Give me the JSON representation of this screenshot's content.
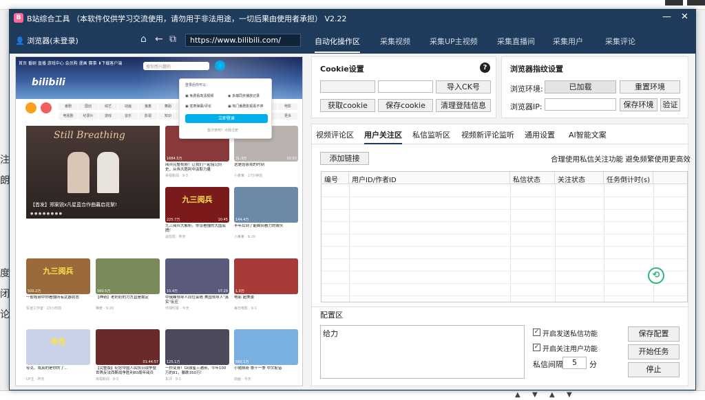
{
  "window": {
    "title": "B站综合工具 （本软件仅供学习交流使用，请勿用于非法用途，一切后果由使用者承担） V2.22",
    "logo": "B"
  },
  "background": {
    "left_fragments": [
      "注",
      "朗",
      "度:",
      "闭",
      "论"
    ]
  },
  "nav": {
    "user_label": "浏览器(未登录)",
    "url": "https://www.bilibili.com/",
    "tabs": [
      "自动化操作区",
      "采集视频",
      "采集UP主视频",
      "采集直播间",
      "采集用户",
      "采集评论"
    ],
    "active_tab": "自动化操作区"
  },
  "bili": {
    "nav_text": "首页 番剧 直播 游戏中心 会员购 漫画 赛事 ⬇下载客户端",
    "search_placeholder": "搜你感兴趣的",
    "logo": "bilibili",
    "cats": [
      "番剧",
      "国创",
      "综艺",
      "动画",
      "鬼畜",
      "舞蹈",
      "娱乐",
      "科技",
      "美食",
      "汽车",
      "运动",
      "电影",
      "电视剧",
      "纪录片",
      "游戏",
      "音乐",
      "影视",
      "知识",
      "资讯",
      "生活",
      "时尚",
      "动物",
      "搞笑",
      "更多"
    ],
    "banner_title": "Still Breathing",
    "banner_caption": "【首发】郑案锐x凡星蓝合作曲暮启花絮!",
    "popup": {
      "header": "登录后你可以：",
      "items": [
        "免费看高清视频",
        "多端同步播放记录",
        "发表弹幕/评论",
        "热门番剧影视看不停"
      ],
      "button": "立即登录",
      "footer": "首次使用？点我注册"
    },
    "videos": [
      {
        "title": "阅兵完整视频！让我们一起铭记历史，从伟大胜利中汲取力量",
        "meta": "央视新闻 · 9-3",
        "stat": "1684.5万",
        "dur": "",
        "big": "",
        "color": "#8a3a3a"
      },
      {
        "title": "这是感恩我的时刻",
        "meta": "小某某 · 17分钟前",
        "stat": "31.3万",
        "dur": "02:03",
        "big": "",
        "color": "#b9b2ae"
      },
      {
        "title": "九三阅兵大解析，你没看懂的大国底牌！",
        "meta": "战忽局 · 昨天",
        "stat": "225.7万",
        "dur": "10:45",
        "big": "九三阅兵",
        "color": "#7a1a1a"
      },
      {
        "title": "半年后到了能瞬间看力的眼头",
        "meta": "小某某 · 9-20",
        "stat": "144.4万",
        "dur": "",
        "big": "",
        "color": "#6a8aa8"
      },
      {
        "title": "一般视频中你看懂所有武器状态",
        "meta": "军迷工作室 · 23小时前",
        "stat": "500.2万",
        "dur": "",
        "big": "九三阅兵",
        "color": "#9a6a3a"
      },
      {
        "title": "【神奇】老奶奶的力方直是稳定",
        "meta": "稀奇 · 9-20",
        "stat": "560.5万",
        "dur": "",
        "big": "",
        "color": "#7a8a5a"
      },
      {
        "title": "中俄峰领导人同位会晤 美国领导人\"真实\"反应",
        "meta": "环球时报 · 今天",
        "stat": "15.4万",
        "dur": "07:29",
        "big": "",
        "color": "#5a5a7a"
      },
      {
        "title": "电影 超美景",
        "meta": "每日电影 · 9-1",
        "stat": "1.0万",
        "dur": "",
        "big": "",
        "color": "#a83a3a"
      },
      {
        "title": "夸克、我真的是你的了...",
        "meta": "UP主 · 昨天",
        "stat": "",
        "dur": "",
        "big": "夸克",
        "color": "#c9d2e6"
      },
      {
        "title": "【完整版】纪念中国人民抗日战争暨世界反法西斯战争胜利80周年阅兵",
        "meta": "央视新闻 · 9-3",
        "stat": "",
        "dur": "01:44:57",
        "big": "",
        "color": "#6a2a2a"
      },
      {
        "title": "一秒变身！Gt球星三通用，今年100万的81，暴跌350万！",
        "meta": "车评 · 9-1",
        "stat": "125.1万",
        "dur": "",
        "big": "",
        "color": "#4a4a5a"
      },
      {
        "title": "小猪佩奇 第十一季 中文配音",
        "meta": "动画 · 今天",
        "stat": "560.1万",
        "dur": "",
        "big": "",
        "color": "#7ab0e0"
      }
    ]
  },
  "cookie": {
    "title": "Cookie设置",
    "import_btn": "导入CK号",
    "get_btn": "获取cookie",
    "save_btn": "保存cookie",
    "clear_btn": "清理登陆信息"
  },
  "fingerprint": {
    "title": "浏览器指纹设置",
    "env_label": "浏览环境:",
    "env_status": "已加载",
    "reset_btn": "重置环境",
    "ip_label": "浏览器IP:",
    "save_env_btn": "保存环境",
    "verify_btn": "验证"
  },
  "subtabs": {
    "items": [
      "视频评论区",
      "用户关注区",
      "私信监听区",
      "视频新评论监听",
      "通用设置",
      "AI智能文案"
    ],
    "active": "用户关注区"
  },
  "follow": {
    "add_link_btn": "添加链接",
    "tip": "合理使用私信关注功能 避免频繁使用更高效",
    "columns": [
      "编号",
      "用户ID/作者ID",
      "私信状态",
      "关注状态",
      "任务倒计时(s)"
    ]
  },
  "config": {
    "title": "配置区",
    "message": "给力",
    "send_dm_label": "开启发送私信功能",
    "follow_label": "开启关注用户功能",
    "interval_label": "私信间隔",
    "interval_value": "5",
    "interval_unit": "分",
    "save_btn": "保存配置",
    "start_btn": "开始任务",
    "stop_btn": "停止"
  }
}
